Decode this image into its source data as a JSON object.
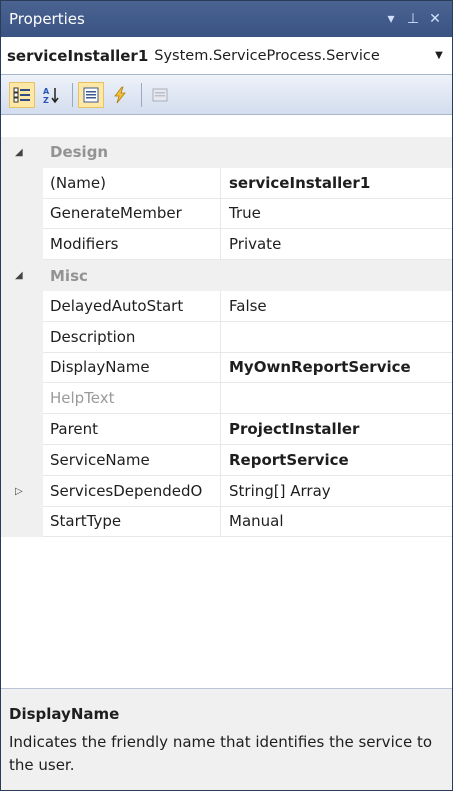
{
  "window": {
    "title": "Properties",
    "buttons": {
      "dropdown": "▾",
      "pin": "⊥",
      "close": "✕"
    }
  },
  "object_selector": {
    "name": "serviceInstaller1",
    "type": "System.ServiceProcess.Service"
  },
  "toolbar": {
    "icons": [
      "categorized-icon",
      "alphabetical-icon",
      "properties-icon",
      "events-icon",
      "property-pages-icon"
    ]
  },
  "grid": {
    "categories": [
      {
        "name": "Design",
        "properties": [
          {
            "name": "(Name)",
            "value": "serviceInstaller1",
            "bold": true
          },
          {
            "name": "GenerateMember",
            "value": "True",
            "bold": false
          },
          {
            "name": "Modifiers",
            "value": "Private",
            "bold": false
          }
        ]
      },
      {
        "name": "Misc",
        "properties": [
          {
            "name": "DelayedAutoStart",
            "value": "False",
            "bold": false
          },
          {
            "name": "Description",
            "value": "",
            "bold": false
          },
          {
            "name": "DisplayName",
            "value": "MyOwnReportService",
            "bold": true
          },
          {
            "name": "HelpText",
            "value": "",
            "bold": false,
            "disabled": true
          },
          {
            "name": "Parent",
            "value": "ProjectInstaller",
            "bold": true
          },
          {
            "name": "ServiceName",
            "value": "ReportService",
            "bold": true
          },
          {
            "name": "ServicesDependedO",
            "value": "String[] Array",
            "bold": false,
            "expandable": true
          },
          {
            "name": "StartType",
            "value": "Manual",
            "bold": false
          }
        ]
      }
    ]
  },
  "description": {
    "title": "DisplayName",
    "text": "Indicates the friendly name that identifies the service to the user."
  },
  "colors": {
    "titlebar": "#3a5383",
    "selection_highlight": "#ffe8a6",
    "category_text": "#939393"
  }
}
